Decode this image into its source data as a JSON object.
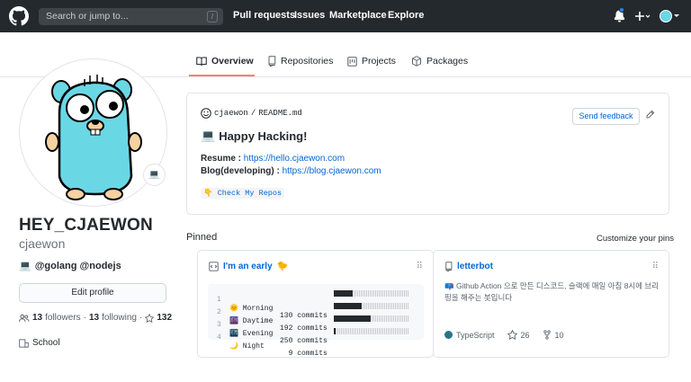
{
  "header": {
    "search_placeholder": "Search or jump to...",
    "search_shortcut": "/",
    "nav": [
      "Pull requests",
      "Issues",
      "Marketplace",
      "Explore"
    ],
    "plus_label": "+",
    "accent_notification": "#2188ff"
  },
  "tabs": [
    {
      "label": "Overview",
      "icon": "book-icon",
      "active": true
    },
    {
      "label": "Repositories",
      "icon": "repo-icon"
    },
    {
      "label": "Projects",
      "icon": "project-icon"
    },
    {
      "label": "Packages",
      "icon": "package-icon"
    }
  ],
  "profile": {
    "status_emoji": "💻",
    "fullname": "HEY_CJAEWON",
    "username": "cjaewon",
    "bio_emoji": "💻",
    "bio": "@golang @nodejs",
    "edit_label": "Edit profile",
    "followers_count": "13",
    "followers_label": "followers",
    "sep": "·",
    "following_count": "13",
    "following_label": "following",
    "stars_count": "132",
    "school": "School"
  },
  "readme": {
    "owner": "cjaewon",
    "slash": "/",
    "file": "README.md",
    "feedback_label": "Send feedback",
    "heading_emoji": "💻",
    "heading": "Happy Hacking!",
    "resume_label": "Resume :",
    "resume_url": "https://hello.cjaewon.com",
    "blog_label": "Blog(developing) :",
    "blog_url": "https://blog.cjaewon.com",
    "repos_emoji": "👇",
    "repos_text": "Check My Repos"
  },
  "pinned": {
    "label": "Pinned",
    "customize_label": "Customize your pins",
    "cards": [
      {
        "title": "I'm an early",
        "title_emoji": "🐤",
        "rows": [
          {
            "n": "1",
            "emoji": "🌞",
            "label": "Morning",
            "commits": "130 commits",
            "fraction": 0.25
          },
          {
            "n": "2",
            "emoji": "🌆",
            "label": "Daytime",
            "commits": "192 commits",
            "fraction": 0.37
          },
          {
            "n": "3",
            "emoji": "🌃",
            "label": "Evening",
            "commits": "250 commits",
            "fraction": 0.49
          },
          {
            "n": "4",
            "emoji": "🌙",
            "label": "Night",
            "commits": "  9 commits",
            "fraction": 0.02
          }
        ]
      },
      {
        "title": "letterbot",
        "desc": "📪 Github Action 으로 만든 디스코드, 슬랙에 매일 아침 8시에 브리핑을 해주는 봇입니다",
        "language": "TypeScript",
        "language_color": "#2b7489",
        "stars": "26",
        "forks": "10"
      }
    ]
  },
  "colors": {
    "header_bg": "#24292e",
    "link": "#0366d6",
    "tab_underline": "#f9826c",
    "gopher": "#6ad7e5"
  }
}
